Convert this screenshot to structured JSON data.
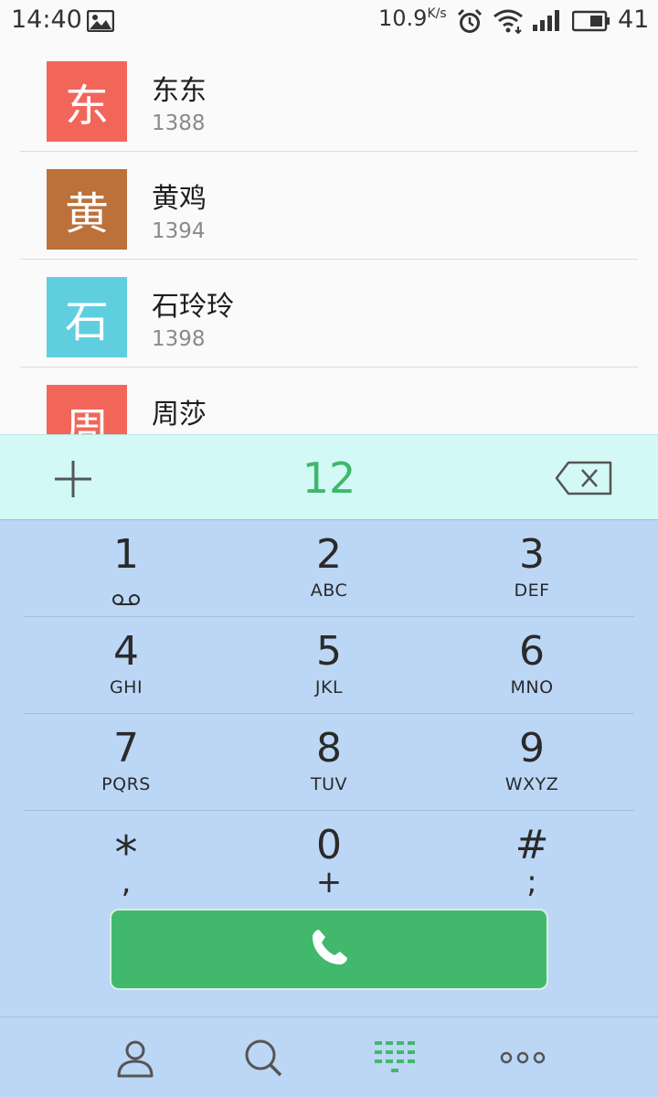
{
  "status_bar": {
    "time": "14:40",
    "network_speed": "10.9",
    "network_speed_unit": "K/s",
    "battery_level": "41",
    "icons": [
      "gallery-icon",
      "alarm-icon",
      "wifi-icon",
      "signal-icon",
      "battery-icon"
    ]
  },
  "contacts": [
    {
      "avatar_char": "东",
      "name": "东东",
      "number": "1388",
      "avatar_color": "#f2665a"
    },
    {
      "avatar_char": "黄",
      "name": "黄鸡",
      "number": "1394",
      "avatar_color": "#bc703a"
    },
    {
      "avatar_char": "石",
      "name": "石玲玲",
      "number": "1398",
      "avatar_color": "#5fcfdf"
    },
    {
      "avatar_char": "周",
      "name": "周莎",
      "number": "",
      "avatar_color": "#f2665a"
    }
  ],
  "dialer": {
    "input": "12",
    "add_icon": "plus-icon",
    "backspace_icon": "backspace-icon"
  },
  "keypad": {
    "keys": [
      {
        "digit": "1",
        "letters": "",
        "sub_icon": "voicemail-icon"
      },
      {
        "digit": "2",
        "letters": "ABC"
      },
      {
        "digit": "3",
        "letters": "DEF"
      },
      {
        "digit": "4",
        "letters": "GHI"
      },
      {
        "digit": "5",
        "letters": "JKL"
      },
      {
        "digit": "6",
        "letters": "MNO"
      },
      {
        "digit": "7",
        "letters": "PQRS"
      },
      {
        "digit": "8",
        "letters": "TUV"
      },
      {
        "digit": "9",
        "letters": "WXYZ"
      },
      {
        "digit": "*",
        "sub": ","
      },
      {
        "digit": "0",
        "sub": "+"
      },
      {
        "digit": "#",
        "sub": ";"
      }
    ],
    "call_icon": "phone-icon"
  },
  "bottom_nav": {
    "items": [
      "contacts-icon",
      "search-icon",
      "dialpad-icon",
      "more-icon"
    ],
    "active": "dialpad-icon"
  },
  "colors": {
    "accent_green": "#41b86c",
    "dialed_number": "#3fb76a",
    "keypad_bg": "#bcd6f5",
    "input_bar_bg": "#d3f9f7"
  }
}
